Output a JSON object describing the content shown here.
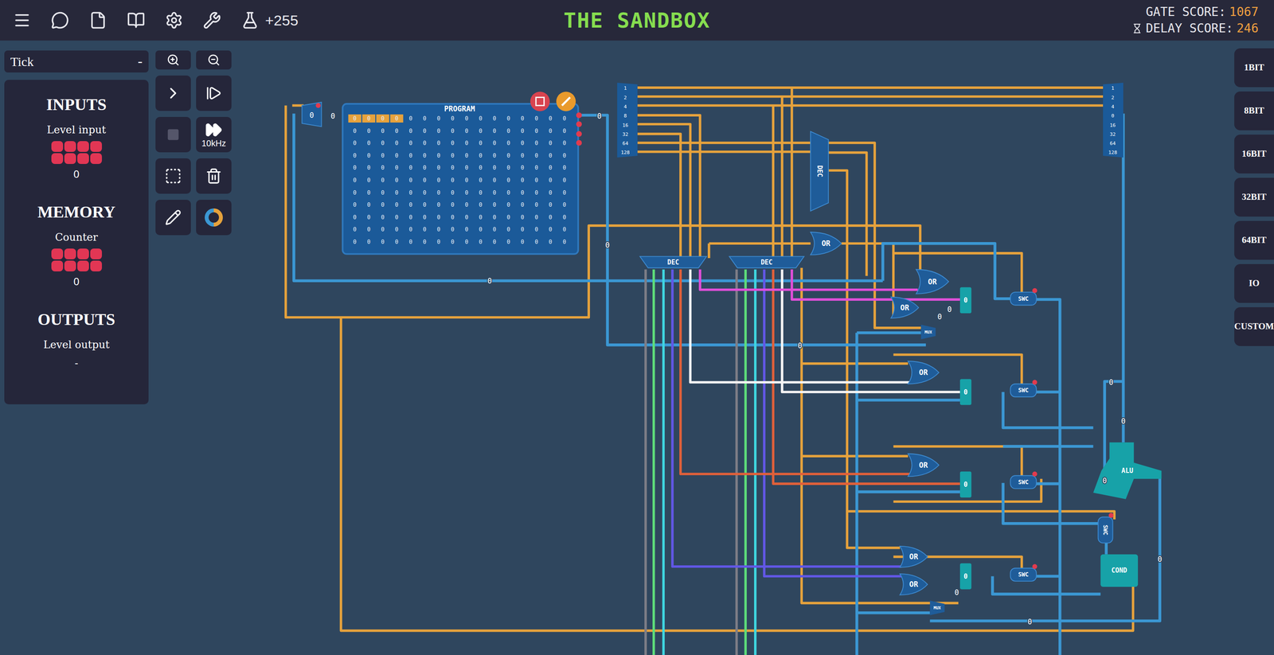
{
  "topbar": {
    "title": "THE SANDBOX",
    "score_badge": "+255",
    "gate_score_label": "GATE SCORE:",
    "gate_score": "1067",
    "delay_score_label": "DELAY SCORE:",
    "delay_score": "246"
  },
  "tick_select": {
    "value": "Tick",
    "collapse": "-"
  },
  "tools": {
    "speed_label": "10kHz",
    "stop_disabled": true
  },
  "panel": {
    "sections": [
      {
        "title": "INPUTS",
        "items": [
          {
            "label": "Level input",
            "kind": "byte",
            "value": "0"
          }
        ]
      },
      {
        "title": "MEMORY",
        "items": [
          {
            "label": "Counter",
            "kind": "byte",
            "value": "0"
          }
        ]
      },
      {
        "title": "OUTPUTS",
        "items": [
          {
            "label": "Level output",
            "kind": "text",
            "value": "-"
          }
        ]
      }
    ]
  },
  "side_buttons": [
    "1BIT",
    "8BIT",
    "16BIT",
    "32BIT",
    "64BIT",
    "IO",
    "CUSTOM"
  ],
  "canvas": {
    "counter": {
      "value": "0"
    },
    "program": {
      "title": "PROGRAM",
      "cursor": {
        "row": 0,
        "count": 4
      },
      "grid": [
        [
          "0",
          "0",
          "0",
          "0",
          "0",
          "0",
          "0",
          "0",
          "0",
          "0",
          "0",
          "0",
          "0",
          "0",
          "0",
          "0"
        ],
        [
          "0",
          "0",
          "0",
          "0",
          "0",
          "0",
          "0",
          "0",
          "0",
          "0",
          "0",
          "0",
          "0",
          "0",
          "0",
          "0"
        ],
        [
          "0",
          "0",
          "0",
          "0",
          "0",
          "0",
          "0",
          "0",
          "0",
          "0",
          "0",
          "0",
          "0",
          "0",
          "0",
          "0"
        ],
        [
          "0",
          "0",
          "0",
          "0",
          "0",
          "0",
          "0",
          "0",
          "0",
          "0",
          "0",
          "0",
          "0",
          "0",
          "0",
          "0"
        ],
        [
          "0",
          "0",
          "0",
          "0",
          "0",
          "0",
          "0",
          "0",
          "0",
          "0",
          "0",
          "0",
          "0",
          "0",
          "0",
          "0"
        ],
        [
          "0",
          "0",
          "0",
          "0",
          "0",
          "0",
          "0",
          "0",
          "0",
          "0",
          "0",
          "0",
          "0",
          "0",
          "0",
          "0"
        ],
        [
          "0",
          "0",
          "0",
          "0",
          "0",
          "0",
          "0",
          "0",
          "0",
          "0",
          "0",
          "0",
          "0",
          "0",
          "0",
          "0"
        ],
        [
          "0",
          "0",
          "0",
          "0",
          "0",
          "0",
          "0",
          "0",
          "0",
          "0",
          "0",
          "0",
          "0",
          "0",
          "0",
          "0"
        ],
        [
          "0",
          "0",
          "0",
          "0",
          "0",
          "0",
          "0",
          "0",
          "0",
          "0",
          "0",
          "0",
          "0",
          "0",
          "0",
          "0"
        ],
        [
          "0",
          "0",
          "0",
          "0",
          "0",
          "0",
          "0",
          "0",
          "0",
          "0",
          "0",
          "0",
          "0",
          "0",
          "0",
          "0"
        ],
        [
          "0",
          "0",
          "0",
          "0",
          "0",
          "0",
          "0",
          "0",
          "0",
          "0",
          "0",
          "0",
          "0",
          "0",
          "0",
          "0"
        ]
      ]
    },
    "input_bus": {
      "bits": [
        "1",
        "2",
        "4",
        "8",
        "16",
        "32",
        "64",
        "128"
      ]
    },
    "output_bus": {
      "bits": [
        "1",
        "2",
        "4",
        "0",
        "16",
        "32",
        "64",
        "128"
      ]
    },
    "components": [
      {
        "kind": "decv",
        "label": "DEC"
      },
      {
        "kind": "or",
        "label": "OR"
      },
      {
        "kind": "dec",
        "label": "DEC"
      },
      {
        "kind": "dec",
        "label": "DEC"
      },
      {
        "kind": "or",
        "label": "OR"
      },
      {
        "kind": "or",
        "label": "OR"
      },
      {
        "kind": "mux",
        "label": "MUX"
      },
      {
        "kind": "reg",
        "label": "0"
      },
      {
        "kind": "swc",
        "label": "SWC"
      },
      {
        "kind": "or",
        "label": "OR"
      },
      {
        "kind": "reg",
        "label": "0"
      },
      {
        "kind": "swc",
        "label": "SWC"
      },
      {
        "kind": "or",
        "label": "OR"
      },
      {
        "kind": "reg",
        "label": "0"
      },
      {
        "kind": "swc",
        "label": "SWC"
      },
      {
        "kind": "or",
        "label": "OR"
      },
      {
        "kind": "or",
        "label": "OR"
      },
      {
        "kind": "reg",
        "label": "0"
      },
      {
        "kind": "swc",
        "label": "SWC"
      },
      {
        "kind": "mux",
        "label": "MUX"
      },
      {
        "kind": "swcv",
        "label": "SWC"
      },
      {
        "kind": "alu",
        "label": "ALU"
      },
      {
        "kind": "cond",
        "label": "COND"
      }
    ],
    "wire_values": [
      "0",
      "0",
      "0",
      "0",
      "0",
      "0",
      "0",
      "0",
      "0",
      "0",
      "0",
      "0",
      "0"
    ]
  }
}
